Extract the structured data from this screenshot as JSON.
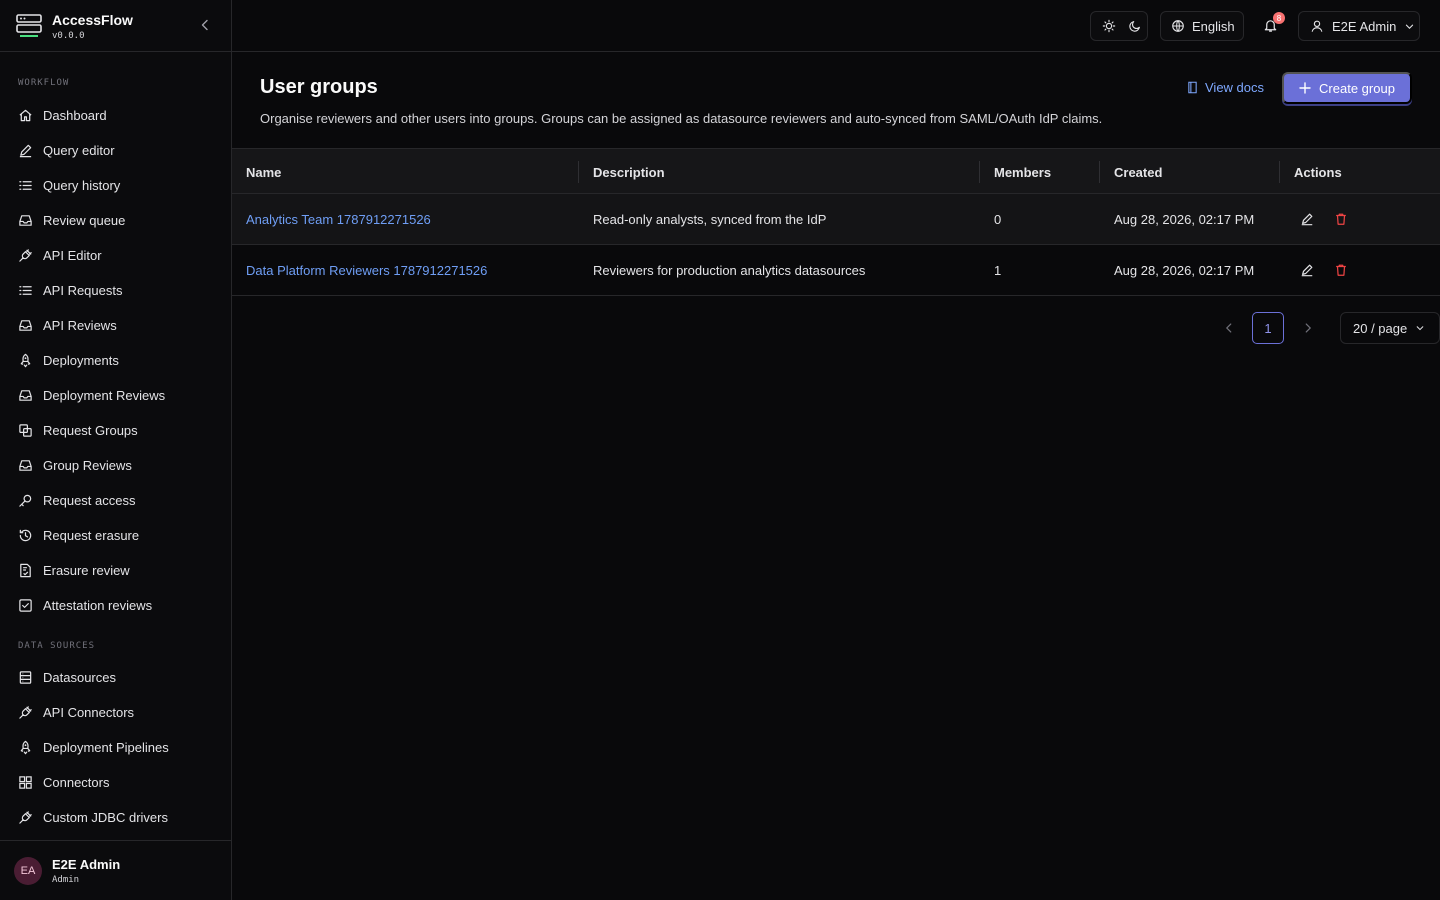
{
  "app": {
    "name": "AccessFlow",
    "version": "v0.0.0"
  },
  "sidebar": {
    "section_workflow": "WORKFLOW",
    "workflow_items": [
      {
        "label": "Dashboard",
        "icon": "home-icon"
      },
      {
        "label": "Query editor",
        "icon": "pencil-icon"
      },
      {
        "label": "Query history",
        "icon": "list-icon"
      },
      {
        "label": "Review queue",
        "icon": "inbox-icon"
      },
      {
        "label": "API Editor",
        "icon": "plug-icon"
      },
      {
        "label": "API Requests",
        "icon": "list-icon"
      },
      {
        "label": "API Reviews",
        "icon": "inbox-icon"
      },
      {
        "label": "Deployments",
        "icon": "rocket-icon"
      },
      {
        "label": "Deployment Reviews",
        "icon": "inbox-icon"
      },
      {
        "label": "Request Groups",
        "icon": "copy-icon"
      },
      {
        "label": "Group Reviews",
        "icon": "inbox-icon"
      },
      {
        "label": "Request access",
        "icon": "key-icon"
      },
      {
        "label": "Request erasure",
        "icon": "history-icon"
      },
      {
        "label": "Erasure review",
        "icon": "file-check-icon"
      },
      {
        "label": "Attestation reviews",
        "icon": "checkbox-icon"
      }
    ],
    "section_datasources": "DATA SOURCES",
    "datasource_items": [
      {
        "label": "Datasources",
        "icon": "database-icon"
      },
      {
        "label": "API Connectors",
        "icon": "plug-icon"
      },
      {
        "label": "Deployment Pipelines",
        "icon": "rocket-icon"
      },
      {
        "label": "Connectors",
        "icon": "grid-icon"
      },
      {
        "label": "Custom JDBC drivers",
        "icon": "plug-icon"
      }
    ],
    "user": {
      "initials": "EA",
      "name": "E2E Admin",
      "role": "Admin"
    }
  },
  "topbar": {
    "language": "English",
    "notification_count": "8",
    "user_menu": "E2E Admin"
  },
  "page": {
    "title": "User groups",
    "description": "Organise reviewers and other users into groups. Groups can be assigned as datasource reviewers and auto-synced from SAML/OAuth IdP claims.",
    "view_docs": "View docs",
    "create_group": "Create group"
  },
  "table": {
    "columns": [
      "Name",
      "Description",
      "Members",
      "Created",
      "Actions"
    ],
    "rows": [
      {
        "name": "Analytics Team 1787912271526",
        "description": "Read-only analysts, synced from the IdP",
        "members": "0",
        "created": "Aug 28, 2026, 02:17 PM"
      },
      {
        "name": "Data Platform Reviewers 1787912271526",
        "description": "Reviewers for production analytics datasources",
        "members": "1",
        "created": "Aug 28, 2026, 02:17 PM"
      }
    ]
  },
  "pagination": {
    "current_page": "1",
    "page_size": "20 / page"
  },
  "colors": {
    "accent": "#6b70d8",
    "link": "#6f9ef5",
    "danger": "#ef4444",
    "background": "#09090b"
  }
}
